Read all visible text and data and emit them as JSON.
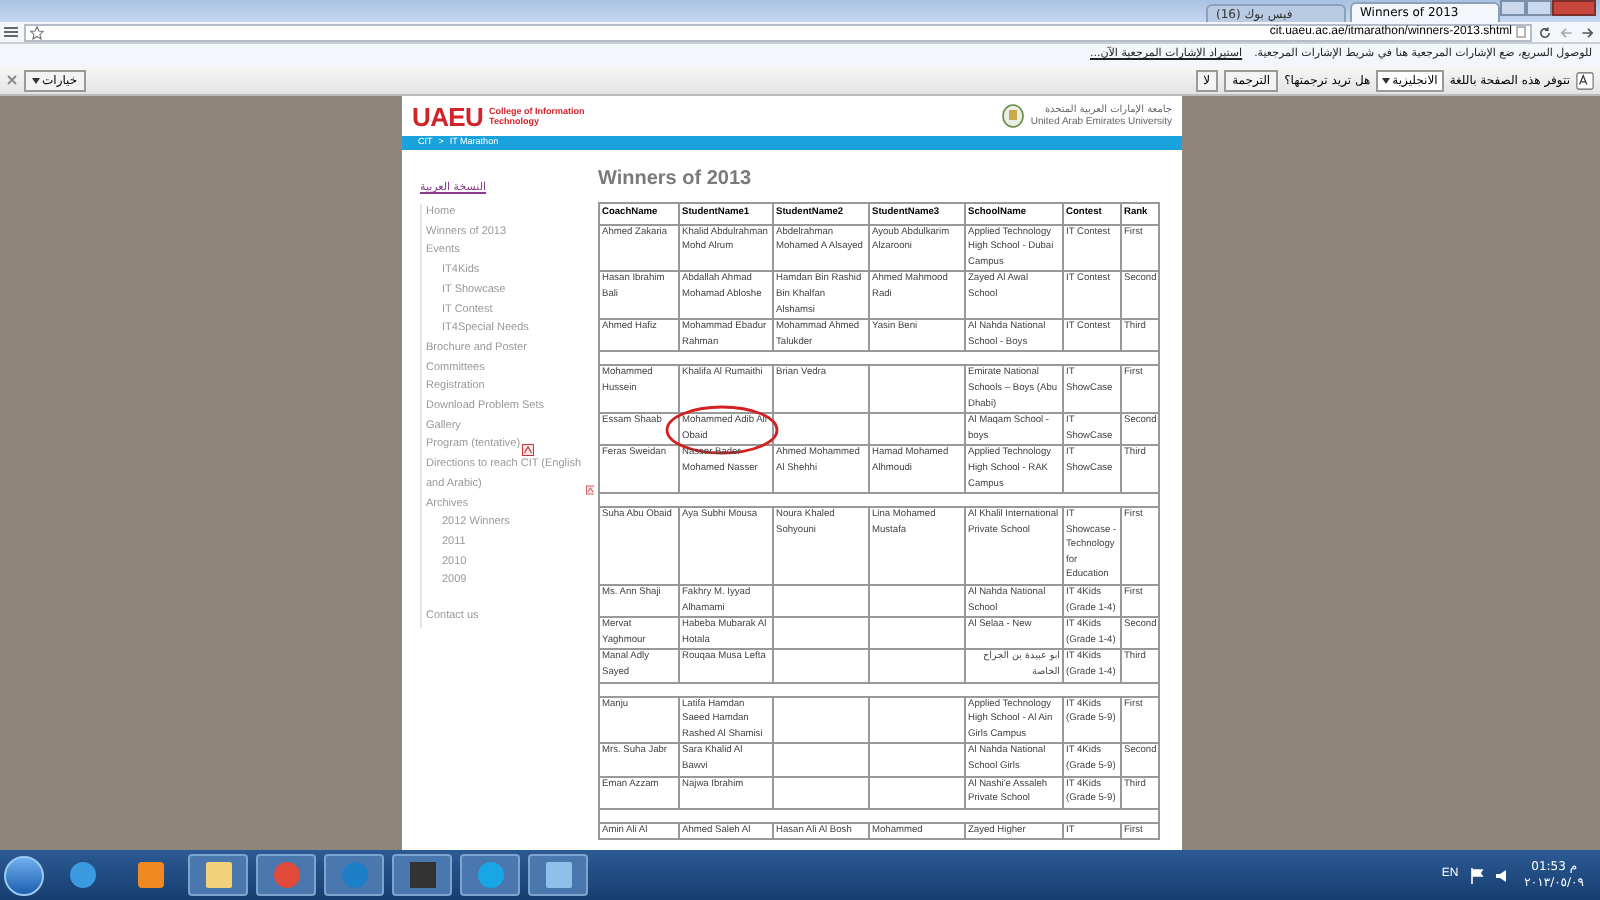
{
  "browser": {
    "tabs": [
      {
        "title": "(16) فيس بوك",
        "selected": false
      },
      {
        "title": "Winners of 2013",
        "selected": true
      }
    ],
    "url": "cit.uaeu.ac.ae/itmarathon/winners-2013.shtml",
    "bookmarks_bar": {
      "label": "للوصول السريع، ضع الإشارات المرجعية هنا في شريط الإشارات المرجعية.",
      "link": "استيراد الإشارات المرجعية الآن..."
    },
    "translate_bar": {
      "prefix": "تتوفر هذه الصفحة باللغة",
      "language": "الانجليزية",
      "question": "هل تريد ترجمتها؟",
      "translate_button": "الترجمة",
      "no_button": "لا",
      "options": "خيارات"
    }
  },
  "header": {
    "logo": "UAEU",
    "college": "College of Information Technology",
    "university_ar": "جامعة الإمارات العربية المتحدة",
    "university_en": "United Arab Emirates University"
  },
  "breadcrumb": [
    "CIT",
    "IT Marathon"
  ],
  "breadcrumb_separator": ">",
  "sidebar": {
    "language_link": "النسخة العربية",
    "items": [
      {
        "label": "Home",
        "pdf": false
      },
      {
        "label": "Winners of 2013",
        "pdf": false
      },
      {
        "label": "Events",
        "pdf": false,
        "children": [
          {
            "label": "IT4Kids",
            "pdf": false
          },
          {
            "label": "IT Showcase",
            "pdf": false
          },
          {
            "label": "IT Contest",
            "pdf": false
          },
          {
            "label": "IT4Special Needs",
            "pdf": false
          }
        ]
      },
      {
        "label": "Brochure and Poster",
        "pdf": false
      },
      {
        "label": "Committees",
        "pdf": false
      },
      {
        "label": "Registration",
        "pdf": false
      },
      {
        "label": "Download Problem Sets",
        "pdf": false
      },
      {
        "label": "Gallery",
        "pdf": false
      },
      {
        "label": "Program (tentative)",
        "pdf": true
      },
      {
        "label": "Directions to reach CIT (English and Arabic)",
        "pdf": true
      },
      {
        "label": "Archives",
        "pdf": false,
        "children": [
          {
            "label": "2012 Winners",
            "pdf": false
          },
          {
            "label": "2011",
            "pdf": false
          },
          {
            "label": "2010",
            "pdf": false
          },
          {
            "label": "2009",
            "pdf": false
          }
        ]
      }
    ],
    "footer_item": "Contact us"
  },
  "title": "Winners of 2013",
  "table": {
    "columns": [
      "CoachName",
      "StudentName1",
      "StudentName2",
      "StudentName3",
      "SchoolName",
      "Contest",
      "Rank"
    ],
    "groups": [
      {
        "rows": [
          {
            "coach": "Ahmed Zakaria",
            "student_1": "Khalid Abdulrahman Mohd Alrum",
            "student_2": "Abdelrahman Mohamed A Alsayed",
            "student_3": "Ayoub Abdulkarim Alzarooni",
            "school": "Applied Technology High School - Dubai Campus",
            "contest": "IT Contest",
            "rank": "First",
            "circled": false
          },
          {
            "coach": "Hasan Ibrahim Bali",
            "student_1": "Abdallah Ahmad Mohamad Abloshe",
            "student_2": "Hamdan Bin Rashid Bin Khalfan Alshamsi",
            "student_3": "Ahmed Mahmood Radi",
            "school": "Zayed Al Awal School",
            "contest": "IT Contest",
            "rank": "Second",
            "circled": false
          },
          {
            "coach": "Ahmed Hafiz",
            "student_1": "Mohammad Ebadur Rahman",
            "student_2": "Mohammad Ahmed Talukder",
            "student_3": "Yasin Beni",
            "school": "Al Nahda National School - Boys",
            "contest": "IT Contest",
            "rank": "Third",
            "circled": false
          }
        ]
      },
      {
        "rows": [
          {
            "coach": "Mohammed Hussein",
            "student_1": "Khalifa Al Rumaithi",
            "student_2": "Brian Vedra",
            "school": "Emirate National Schools – Boys (Abu Dhabi)",
            "contest": "IT ShowCase",
            "rank": "First",
            "circled": false
          },
          {
            "coach": "Essam Shaab",
            "student_1": "Mohammed Adib Ali Obaid",
            "school": "Al Maqam School - boys",
            "contest": "IT ShowCase",
            "rank": "Second",
            "circled": true
          },
          {
            "coach": "Feras Sweidan",
            "student_1": "Nasser Bader Mohamed Nasser",
            "student_2": "Ahmed Mohammed Al Shehhi",
            "student_3": "Hamad Mohamed Alhmoudi",
            "school": "Applied Technology High School - RAK Campus",
            "contest": "IT ShowCase",
            "rank": "Third",
            "circled": false
          }
        ]
      },
      {
        "rows": [
          {
            "coach": "Suha Abu Obaid",
            "student_1": "Aya Subhi Mousa",
            "student_2": "Noura Khaled Sohyouni",
            "student_3": "Lina Mohamed Mustafa",
            "school": "Al Khalil International Private School",
            "contest": "IT Showcase - Technology for Education",
            "rank": "First",
            "circled": false
          },
          {
            "coach": "Ms. Ann Shaji",
            "student_1": "Fakhry M. Iyyad Alhamami",
            "school": "Al Nahda National School",
            "contest": "IT 4Kids (Grade 1-4)",
            "rank": "First",
            "circled": false
          },
          {
            "coach": "Mervat Yaghmour",
            "student_1": "Habeba Mubarak Al Hotala",
            "school": "Al Selaa - New",
            "contest": "IT 4Kids (Grade 1-4)",
            "rank": "Second",
            "circled": false
          },
          {
            "coach": "Manal Adly Sayed",
            "student_1": "Rouqaa Musa Lefta",
            "school": "ابو عبيدة بن الجراح الخاصة",
            "contest": "IT 4Kids (Grade 1-4)",
            "rank": "Third",
            "circled": false
          }
        ]
      },
      {
        "rows": [
          {
            "coach": "Manju",
            "student_1": "Latifa Hamdan Saeed Hamdan Rashed Al Shamisi",
            "school": "Applied Technology High School - Al Ain Girls Campus",
            "contest": "IT 4Kids (Grade 5-9)",
            "rank": "First",
            "circled": false
          },
          {
            "coach": "Mrs. Suha Jabr",
            "student_1": "Sara Khalid Al Bawvi",
            "school": "Al Nahda National School Girls",
            "contest": "IT 4Kids (Grade 5-9)",
            "rank": "Second",
            "circled": false
          },
          {
            "coach": "Eman Azzam",
            "student_1": "Najwa Ibrahim",
            "school": "Al Nashi'e Assaleh Private School",
            "contest": "IT 4Kids (Grade 5-9)",
            "rank": "Third",
            "circled": false
          }
        ]
      },
      {
        "rows": [
          {
            "coach": "Amin Ali Al",
            "student_1": "Ahmed Saleh Al",
            "student_2": "Hasan Ali Al Bosh",
            "student_3": "Mohammed",
            "school": "Zayed Higher",
            "contest": "IT",
            "rank": "First",
            "circled": false
          }
        ]
      }
    ]
  },
  "taskbar": {
    "language": "EN",
    "time": "01:53 م",
    "date": "٢٠١٣/٠٥/٠٩"
  }
}
